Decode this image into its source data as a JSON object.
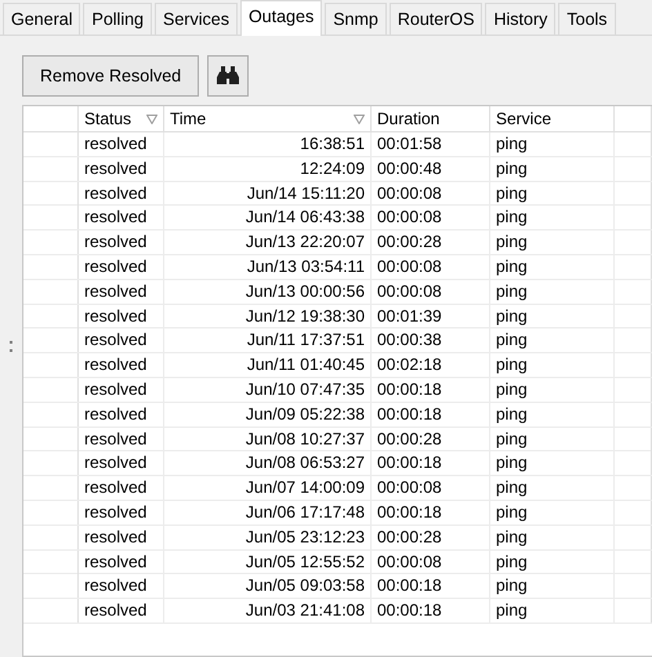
{
  "tabs": [
    {
      "label": "General",
      "selected": false
    },
    {
      "label": "Polling",
      "selected": false
    },
    {
      "label": "Services",
      "selected": false
    },
    {
      "label": "Outages",
      "selected": true
    },
    {
      "label": "Snmp",
      "selected": false
    },
    {
      "label": "RouterOS",
      "selected": false
    },
    {
      "label": "History",
      "selected": false
    },
    {
      "label": "Tools",
      "selected": false
    }
  ],
  "toolbar": {
    "remove_button": "Remove Resolved"
  },
  "table": {
    "columns": [
      {
        "label": "Status",
        "sorted": true
      },
      {
        "label": "Time",
        "sorted": true
      },
      {
        "label": "Duration",
        "sorted": false
      },
      {
        "label": "Service",
        "sorted": false
      }
    ],
    "rows": [
      [
        "resolved",
        "16:38:51",
        "00:01:58",
        "ping"
      ],
      [
        "resolved",
        "12:24:09",
        "00:00:48",
        "ping"
      ],
      [
        "resolved",
        "Jun/14 15:11:20",
        "00:00:08",
        "ping"
      ],
      [
        "resolved",
        "Jun/14 06:43:38",
        "00:00:08",
        "ping"
      ],
      [
        "resolved",
        "Jun/13 22:20:07",
        "00:00:28",
        "ping"
      ],
      [
        "resolved",
        "Jun/13 03:54:11",
        "00:00:08",
        "ping"
      ],
      [
        "resolved",
        "Jun/13 00:00:56",
        "00:00:08",
        "ping"
      ],
      [
        "resolved",
        "Jun/12 19:38:30",
        "00:01:39",
        "ping"
      ],
      [
        "resolved",
        "Jun/11 17:37:51",
        "00:00:38",
        "ping"
      ],
      [
        "resolved",
        "Jun/11 01:40:45",
        "00:02:18",
        "ping"
      ],
      [
        "resolved",
        "Jun/10 07:47:35",
        "00:00:18",
        "ping"
      ],
      [
        "resolved",
        "Jun/09 05:22:38",
        "00:00:18",
        "ping"
      ],
      [
        "resolved",
        "Jun/08 10:27:37",
        "00:00:28",
        "ping"
      ],
      [
        "resolved",
        "Jun/08 06:53:27",
        "00:00:18",
        "ping"
      ],
      [
        "resolved",
        "Jun/07 14:00:09",
        "00:00:08",
        "ping"
      ],
      [
        "resolved",
        "Jun/06 17:17:48",
        "00:00:18",
        "ping"
      ],
      [
        "resolved",
        "Jun/05 23:12:23",
        "00:00:28",
        "ping"
      ],
      [
        "resolved",
        "Jun/05 12:55:52",
        "00:00:08",
        "ping"
      ],
      [
        "resolved",
        "Jun/05 09:03:58",
        "00:00:18",
        "ping"
      ],
      [
        "resolved",
        "Jun/03 21:41:08",
        "00:00:18",
        "ping"
      ]
    ]
  }
}
